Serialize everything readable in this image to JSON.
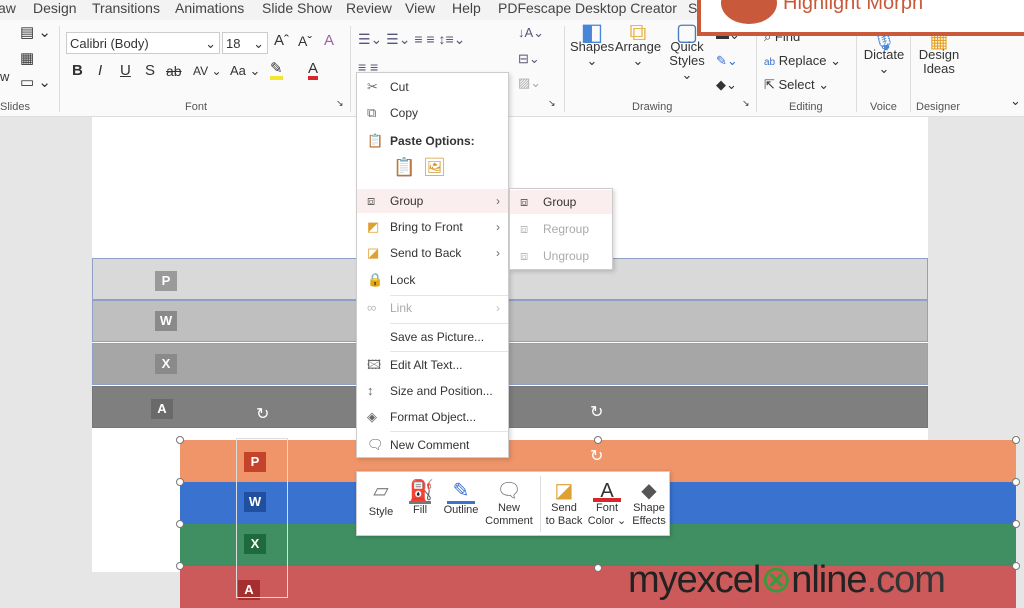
{
  "tabs": [
    "aw",
    "Design",
    "Transitions",
    "Animations",
    "Slide Show",
    "Review",
    "View",
    "Help",
    "PDFescape Desktop Creator",
    "S"
  ],
  "ribbon": {
    "font_name": "Calibri (Body)",
    "font_size": "18",
    "groups": {
      "slides": "Slides",
      "font": "Font",
      "drawing": "Drawing",
      "editing": "Editing",
      "voice": "Voice",
      "designer": "Designer"
    },
    "slides_partial": "w",
    "drawing": {
      "shapes": "Shapes",
      "arrange": "Arrange",
      "quick_styles_1": "Quick",
      "quick_styles_2": "Styles"
    },
    "editing": {
      "find": "Find",
      "replace": "Replace",
      "select": "Select"
    },
    "dictate": "Dictate",
    "design_ideas_1": "Design",
    "design_ideas_2": "Ideas",
    "accent_highlight": "#f5e531",
    "accent_font_color": "#d9262a"
  },
  "overlay": {
    "title": "Highlight Morph",
    "border_color": "#c8593a"
  },
  "context_menu": {
    "items": [
      {
        "label": "Cut",
        "icon": "scissors"
      },
      {
        "label": "Copy",
        "icon": "copy"
      },
      {
        "label": "Paste Options:",
        "icon": "clipboard"
      },
      {
        "label": "Group",
        "icon": "group",
        "submenu": true
      },
      {
        "label": "Bring to Front",
        "icon": "bring-front",
        "submenu": true
      },
      {
        "label": "Send to Back",
        "icon": "send-back",
        "submenu": true
      },
      {
        "label": "Lock",
        "icon": "lock"
      },
      {
        "label": "Link",
        "icon": "link",
        "submenu": true,
        "disabled": true
      },
      {
        "label": "Save as Picture..."
      },
      {
        "label": "Edit Alt Text...",
        "icon": "alt-text"
      },
      {
        "label": "Size and Position...",
        "icon": "size-position"
      },
      {
        "label": "Format Object...",
        "icon": "format"
      },
      {
        "label": "New Comment",
        "icon": "comment"
      }
    ]
  },
  "submenu": {
    "items": [
      {
        "label": "Group"
      },
      {
        "label": "Regroup",
        "disabled": true
      },
      {
        "label": "Ungroup",
        "disabled": true
      }
    ]
  },
  "mini_toolbar": {
    "style": "Style",
    "fill": "Fill",
    "outline": "Outline",
    "new_comment_1": "New",
    "new_comment_2": "Comment",
    "send_back_1": "Send",
    "send_back_2": "to Back",
    "font_color_1": "Font",
    "font_color_2": "Color",
    "shape_effects_1": "Shape",
    "shape_effects_2": "Effects"
  },
  "slide": {
    "gray_bands": [
      {
        "letter": "P",
        "color": "#d9d9d9"
      },
      {
        "letter": "W",
        "color": "#bfbfbf"
      },
      {
        "letter": "X",
        "color": "#a6a6a6"
      },
      {
        "letter": "A",
        "color": "#7f7f7f"
      }
    ],
    "color_bands": [
      {
        "letter": "P",
        "color": "#f0956a"
      },
      {
        "letter": "W",
        "color": "#3a72d0"
      },
      {
        "letter": "X",
        "color": "#3f8f62"
      },
      {
        "letter": "A",
        "color": "#cc5a5a"
      }
    ]
  },
  "watermark": {
    "part1": "myexcel",
    "part2": "nline",
    "part3": ".com"
  }
}
